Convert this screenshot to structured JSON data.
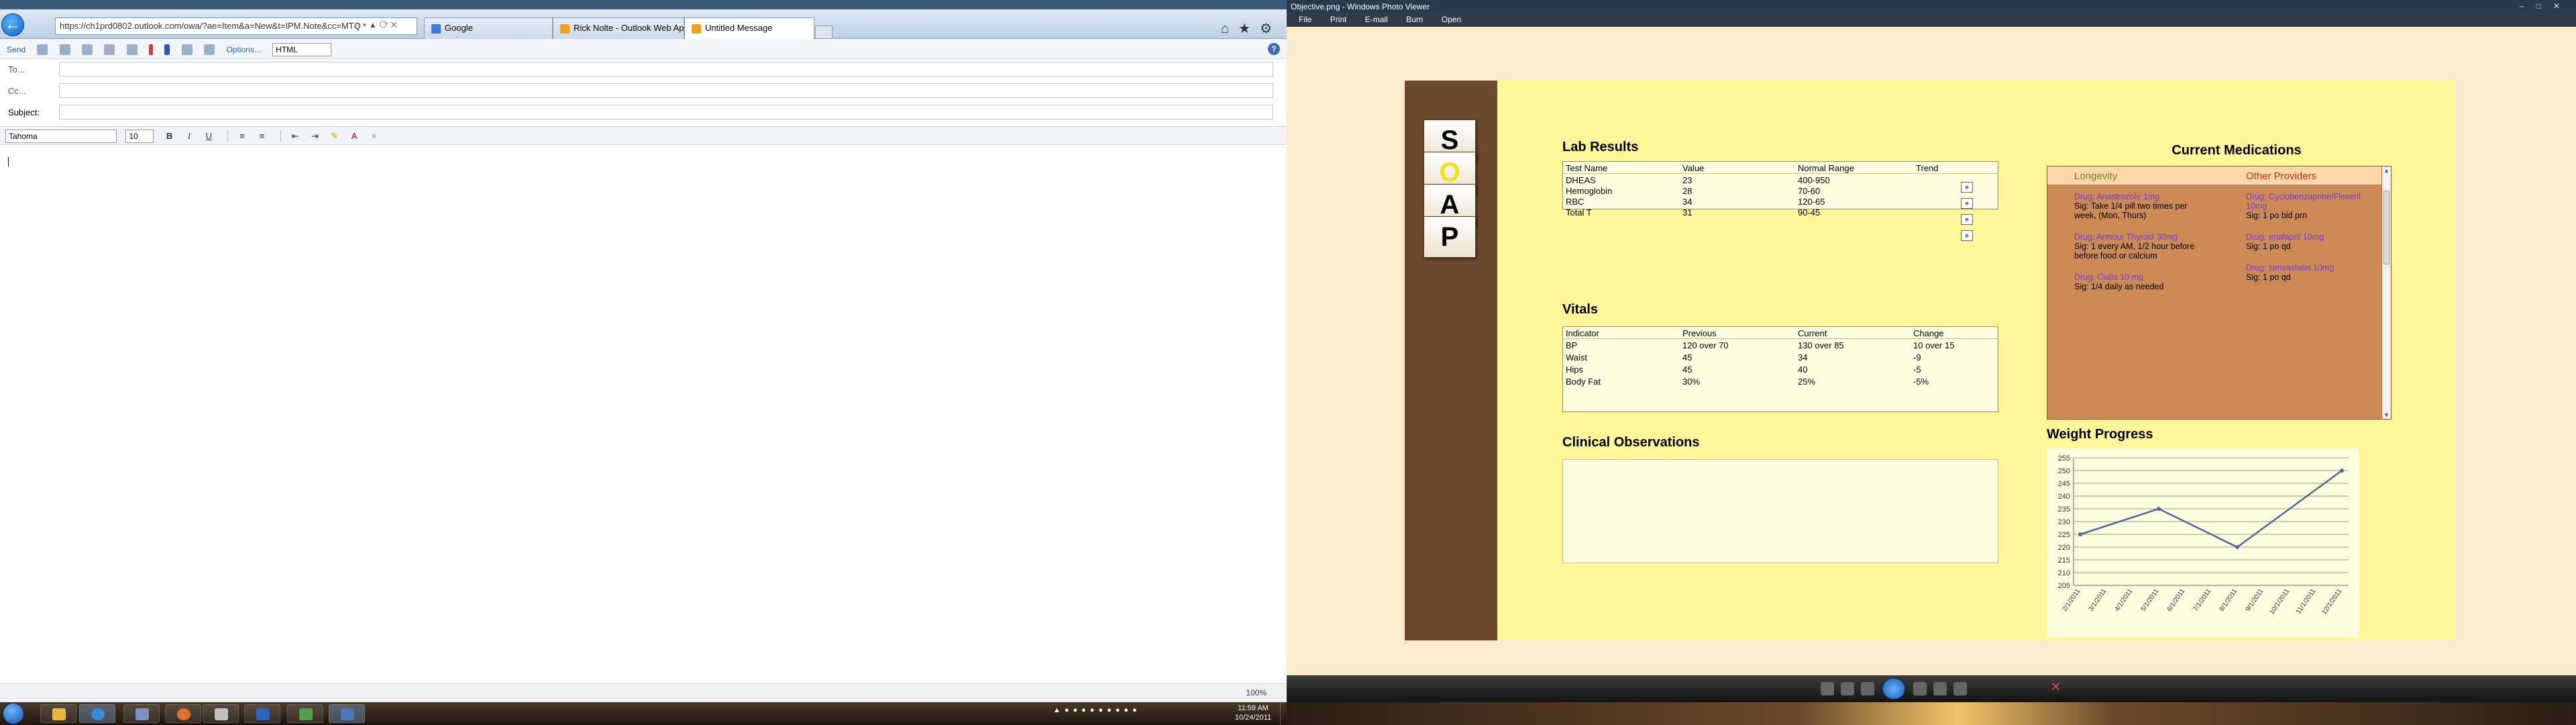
{
  "ie": {
    "address": "https://ch1prd0802.outlook.com/owa/?ae=Item&a=New&t=IPM.Note&cc=MTQ",
    "tabs": [
      {
        "label": "Google",
        "color": "#3a7bd5"
      },
      {
        "label": "Rick Nolte - Outlook Web App",
        "color": "#f0a020"
      },
      {
        "label": "Untitled Message",
        "color": "#f0a020"
      }
    ],
    "toolbar": {
      "send": "Send",
      "options": "Options...",
      "format": "HTML"
    },
    "fields": {
      "to_label": "To...",
      "cc_label": "Cc...",
      "subject_label": "Subject:"
    },
    "format_bar": {
      "font": "Tahoma",
      "size": "10"
    },
    "status": {
      "zoom": "100%"
    }
  },
  "photo_viewer": {
    "title": "Objective.png - Windows Photo Viewer",
    "menu": [
      "File",
      "Print",
      "E-mail",
      "Burn",
      "Open"
    ]
  },
  "soap": {
    "buttons": [
      "S",
      "O",
      "A",
      "P"
    ],
    "active": "O",
    "lab_results": {
      "title": "Lab Results",
      "headers": [
        "Test Name",
        "Value",
        "Normal Range",
        "Trend"
      ],
      "rows": [
        [
          "DHEAS",
          "23",
          "400-950"
        ],
        [
          "Hemoglobin",
          "28",
          "70-60"
        ],
        [
          "RBC",
          "34",
          "120-65"
        ],
        [
          "Total T",
          "31",
          "90-45"
        ]
      ],
      "trend_button": "+"
    },
    "vitals": {
      "title": "Vitals",
      "headers": [
        "Indicator",
        "Previous",
        "Current",
        "Change"
      ],
      "rows": [
        [
          "BP",
          "120 over 70",
          "130 over 85",
          "10 over 15"
        ],
        [
          "Waist",
          "45",
          "34",
          "-9"
        ],
        [
          "Hips",
          "45",
          "40",
          "-5"
        ],
        [
          "Body Fat",
          "30%",
          "25%",
          "-5%"
        ]
      ]
    },
    "clinical_observations": {
      "title": "Clinical Observations"
    },
    "medications": {
      "title": "Current Medications",
      "col1_header": "Longevity",
      "col2_header": "Other Providers",
      "col1": [
        {
          "drug": "Drug: Anastrozole 1mg",
          "sig": "Sig: Take 1/4 pill two times per week, (Mon, Thurs)"
        },
        {
          "drug": "Drug: Armour Thyroid 30mg",
          "sig": "Sig: 1 every AM, 1/2 hour before before food or calcium"
        },
        {
          "drug": "Drug: Cialis 10 mg",
          "sig": "Sig: 1/4 daily as needed"
        }
      ],
      "col2": [
        {
          "drug": "Drug: Cyclobenzaprine/Flexeril 10mg",
          "sig": "Sig: 1 po bid prn"
        },
        {
          "drug": "Drug: enalapril 10mg",
          "sig": "Sig: 1 po qd"
        },
        {
          "drug": "Drug: simvastatin 10mg",
          "sig": "Sig: 1 po qd"
        }
      ]
    },
    "weight_progress": {
      "title": "Weight Progress"
    }
  },
  "chart_data": {
    "type": "line",
    "title": "Weight Progress",
    "x": [
      "2/1/2011",
      "3/1/2011",
      "4/1/2011",
      "5/1/2011",
      "6/1/2011",
      "7/1/2011",
      "8/1/2011",
      "9/1/2011",
      "10/1/2011",
      "11/1/2011",
      "12/1/2011"
    ],
    "points": [
      {
        "x": "2/1/2011",
        "y": 225
      },
      {
        "x": "5/1/2011",
        "y": 235
      },
      {
        "x": "8/1/2011",
        "y": 220
      },
      {
        "x": "12/1/2011",
        "y": 250
      }
    ],
    "yticks": [
      205,
      210,
      215,
      220,
      225,
      230,
      235,
      240,
      245,
      250,
      255
    ],
    "ylim": [
      205,
      255
    ],
    "grid": true,
    "line_color": "#4a6a9a"
  },
  "taskbar": {
    "time": "11:59 AM",
    "date": "10/24/2011"
  }
}
